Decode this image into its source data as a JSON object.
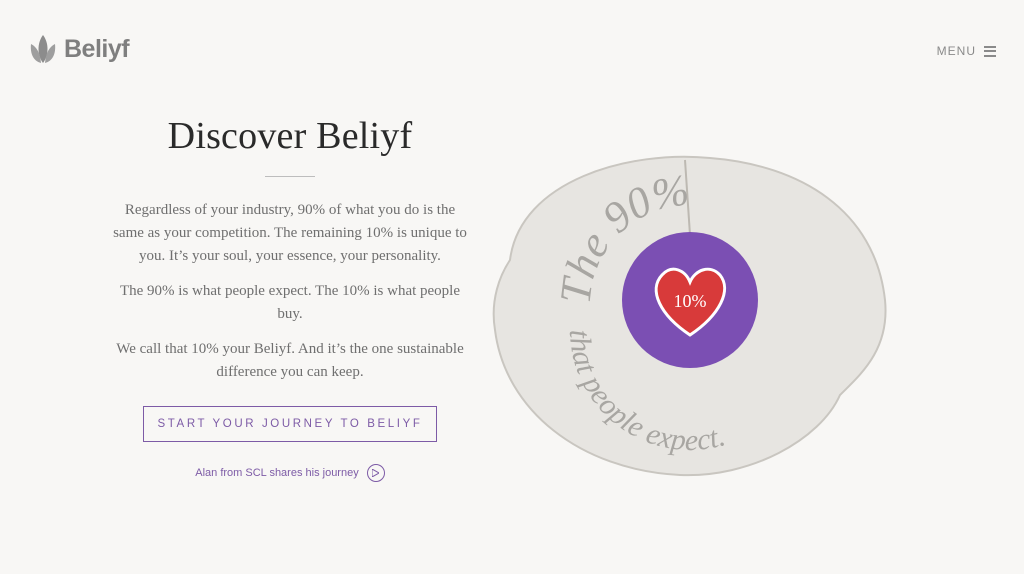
{
  "brand": {
    "name": "Beliyf",
    "logo_color": "#808080"
  },
  "header": {
    "menu_label": "MENU",
    "menu_icon": "hamburger-icon"
  },
  "main": {
    "title": "Discover Beliyf",
    "paragraphs": [
      "Regardless of your industry, 90% of what you do is the same as your competition. The remaining 10% is unique to you. It’s your soul, your essence, your personality.",
      "The 90% is what people expect. The 10% is what people buy.",
      "We call that 10% your Beliyf. And it’s the one sustainable difference you can keep."
    ],
    "cta_label": "START YOUR JOURNEY TO BELIYF",
    "journey_link": "Alan from SCL shares his journey",
    "journey_icon": "play-circle-icon"
  },
  "hero": {
    "ring_words": [
      "The 90%",
      "that people expect."
    ],
    "center_label": "10%",
    "icon": "heart-icon"
  },
  "colors": {
    "accent": "#7d5ba6",
    "purple": "#7b4fb3",
    "red": "#d83a3a",
    "background": "#f8f7f5"
  }
}
